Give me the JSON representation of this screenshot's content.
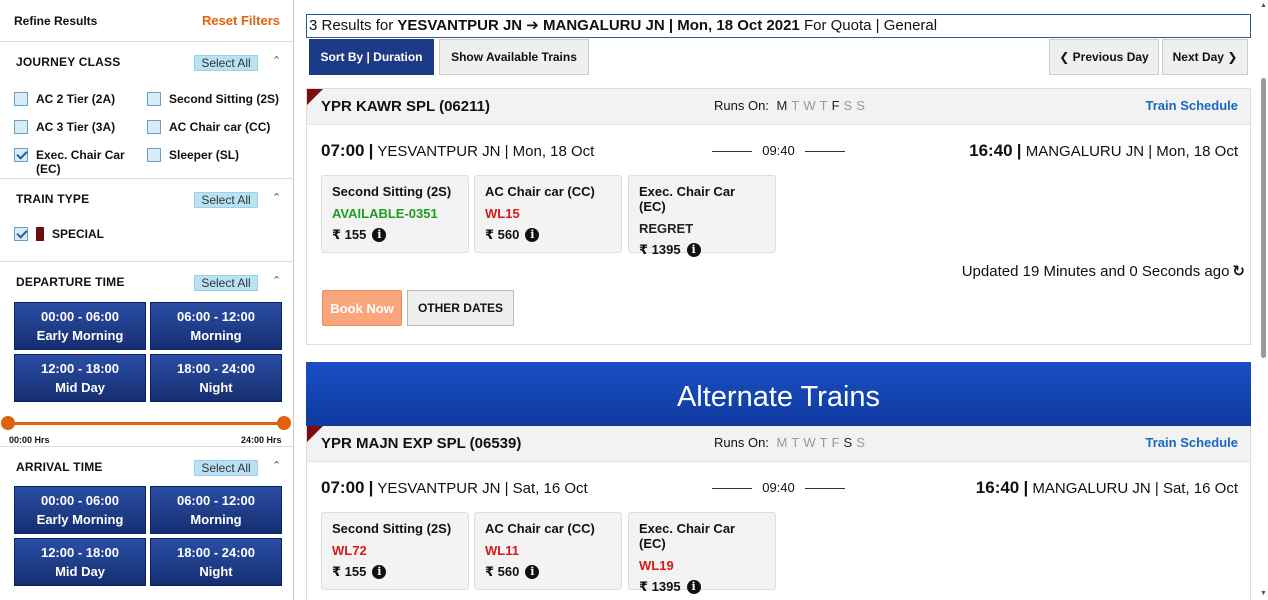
{
  "sidebar": {
    "title": "Refine Results",
    "reset": "Reset Filters",
    "select_all": "Select All",
    "journey_class": {
      "title": "JOURNEY CLASS",
      "options": [
        {
          "label": "AC 2 Tier (2A)",
          "checked": false
        },
        {
          "label": "Second Sitting (2S)",
          "checked": false
        },
        {
          "label": "AC 3 Tier (3A)",
          "checked": false
        },
        {
          "label": "AC Chair car (CC)",
          "checked": false
        },
        {
          "label": "Exec. Chair Car (EC)",
          "checked": true
        },
        {
          "label": "Sleeper (SL)",
          "checked": false
        }
      ]
    },
    "train_type": {
      "title": "TRAIN TYPE",
      "option": "SPECIAL",
      "checked": true
    },
    "departure_time": {
      "title": "DEPARTURE TIME",
      "slots": [
        {
          "range": "00:00 - 06:00",
          "name": "Early Morning"
        },
        {
          "range": "06:00 - 12:00",
          "name": "Morning"
        },
        {
          "range": "12:00 - 18:00",
          "name": "Mid Day"
        },
        {
          "range": "18:00 - 24:00",
          "name": "Night"
        }
      ],
      "slider_min": "00:00 Hrs",
      "slider_max": "24:00 Hrs",
      "slider_start_fraction": 0,
      "slider_end_fraction": 1
    },
    "arrival_time": {
      "title": "ARRIVAL TIME",
      "slots": [
        {
          "range": "00:00 - 06:00",
          "name": "Early Morning"
        },
        {
          "range": "06:00 - 12:00",
          "name": "Morning"
        },
        {
          "range": "12:00 - 18:00",
          "name": "Mid Day"
        },
        {
          "range": "18:00 - 24:00",
          "name": "Night"
        }
      ]
    }
  },
  "results": {
    "count": "3 Results for",
    "route": "YESVANTPUR JN ➔ MANGALURU JN | Mon, 18 Oct 2021",
    "quota_prefix": "For Quota |",
    "quota": "General"
  },
  "toolbar": {
    "sort": "Sort By | Duration",
    "show_available": "Show Available Trains",
    "prev_day": "❮ Previous Day",
    "next_day": "Next Day ❯"
  },
  "trains": [
    {
      "name": "YPR KAWR SPL (06211)",
      "runs_on_label": "Runs On:",
      "days": [
        {
          "d": "M",
          "on": true
        },
        {
          "d": "T",
          "on": false
        },
        {
          "d": "W",
          "on": false
        },
        {
          "d": "T",
          "on": false
        },
        {
          "d": "F",
          "on": true
        },
        {
          "d": "S",
          "on": false
        },
        {
          "d": "S",
          "on": false
        }
      ],
      "schedule_link": "Train Schedule",
      "dep_time": "07:00",
      "dep_info": "YESVANTPUR JN | Mon, 18 Oct",
      "duration": "09:40",
      "arr_time": "16:40",
      "arr_info": "MANGALURU JN | Mon, 18 Oct",
      "classes": [
        {
          "name": "Second Sitting (2S)",
          "avail": "AVAILABLE-0351",
          "status": "green",
          "fare": "₹ 155"
        },
        {
          "name": "AC Chair car (CC)",
          "avail": "WL15",
          "status": "red",
          "fare": "₹ 560"
        },
        {
          "name": "Exec. Chair Car (EC)",
          "avail": "REGRET",
          "status": "dark",
          "fare": "₹ 1395"
        }
      ],
      "updated": "Updated 19 Minutes and 0 Seconds ago",
      "book_now": "Book Now",
      "other_dates": "OTHER DATES"
    },
    {
      "name": "YPR MAJN EXP SPL (06539)",
      "runs_on_label": "Runs On:",
      "days": [
        {
          "d": "M",
          "on": false
        },
        {
          "d": "T",
          "on": false
        },
        {
          "d": "W",
          "on": false
        },
        {
          "d": "T",
          "on": false
        },
        {
          "d": "F",
          "on": false
        },
        {
          "d": "S",
          "on": true
        },
        {
          "d": "S",
          "on": false
        }
      ],
      "schedule_link": "Train Schedule",
      "dep_time": "07:00",
      "dep_info": "YESVANTPUR JN | Sat, 16 Oct",
      "duration": "09:40",
      "arr_time": "16:40",
      "arr_info": "MANGALURU JN | Sat, 16 Oct",
      "classes": [
        {
          "name": "Second Sitting (2S)",
          "avail": "WL72",
          "status": "red",
          "fare": "₹ 155"
        },
        {
          "name": "AC Chair car (CC)",
          "avail": "WL11",
          "status": "red",
          "fare": "₹ 560"
        },
        {
          "name": "Exec. Chair Car (EC)",
          "avail": "WL19",
          "status": "red",
          "fare": "₹ 1395"
        }
      ]
    }
  ],
  "alternate_banner": "Alternate Trains"
}
